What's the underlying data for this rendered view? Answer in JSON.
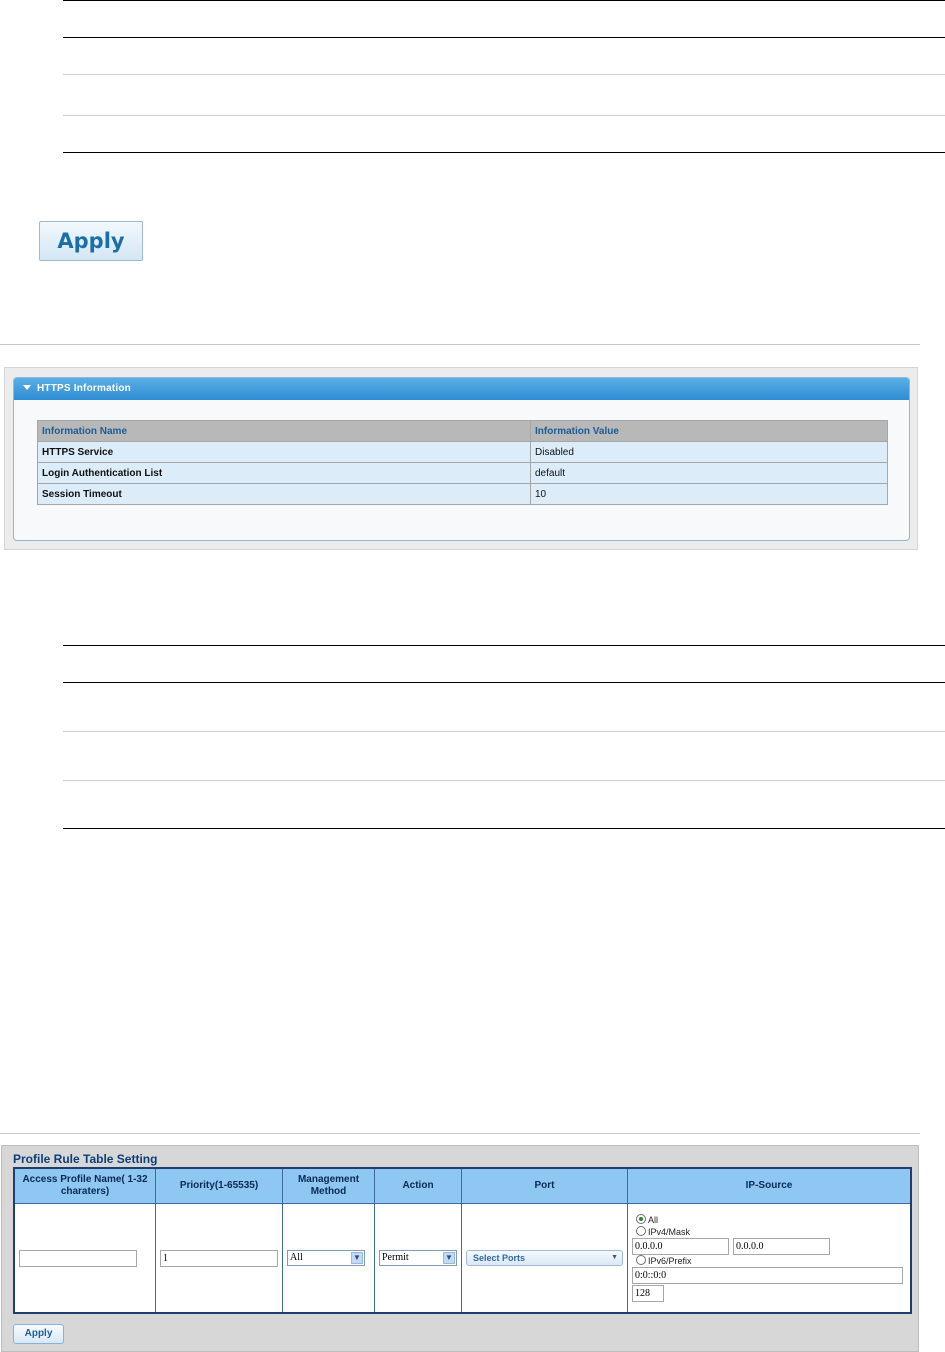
{
  "top_section": {
    "apply_label": "Apply"
  },
  "https_info": {
    "title": "HTTPS Information",
    "columns": [
      "Information Name",
      "Information Value"
    ],
    "rows": [
      {
        "name": "HTTPS Service",
        "value": "Disabled"
      },
      {
        "name": "Login Authentication List",
        "value": "default"
      },
      {
        "name": "Session Timeout",
        "value": "10"
      }
    ]
  },
  "profile_rule": {
    "title": "Profile Rule Table Setting",
    "columns": {
      "name": "Access Profile Name( 1-32 charaters)",
      "priority": "Priority(1-65535)",
      "method": "Management Method",
      "action": "Action",
      "port": "Port",
      "ip_source": "IP-Source"
    },
    "priority_value": "1",
    "method_value": "All",
    "action_value": "Permit",
    "port_button": "Select Ports",
    "ip_source": {
      "all_label": "All",
      "ipv4_label": "IPv4/Mask",
      "ipv4_addr": "0.0.0.0",
      "ipv4_mask": "0.0.0.0",
      "ipv6_label": "IPv6/Prefix",
      "ipv6_addr": "0:0::0:0",
      "ipv6_prefix": "128"
    },
    "apply_label": "Apply"
  }
}
